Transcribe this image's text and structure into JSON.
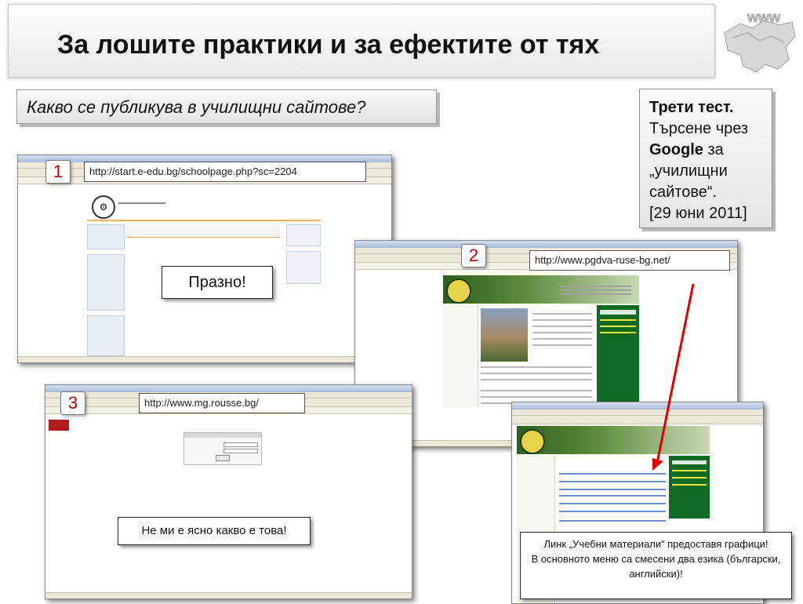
{
  "title": "За лошите практики и за ефектите от тях",
  "subtitle": "Какво се публикува в училищни сайтове?",
  "note": {
    "line1": "Трети тест.",
    "line2": "Търсене чрез",
    "google": "Google",
    "line3_rest": " за",
    "line4": "„училищни сайтове“.",
    "line5": "[29 юни 2011]"
  },
  "logo": {
    "text": "www",
    "icon": "globe-map-icon"
  },
  "screens": [
    {
      "number": "1",
      "url": "http://start.e-edu.bg/schoolpage.php?sc=2204",
      "comment": "Празно!"
    },
    {
      "number": "2",
      "url": "http://www.pgdva-ruse-bg.net/"
    },
    {
      "number": "3",
      "url": "http://www.mg.rousse.bg/",
      "comment": "Не ми е ясно какво е това!"
    }
  ],
  "screen2_comment": {
    "line1": "Линк „Учебни материали“ предоставя графици!",
    "line2": "В основното меню са смесени два езика (български, английски)!"
  },
  "colors": {
    "number_red": "#c00000",
    "arrow_red": "#e00000",
    "site_green": "#0f6a24"
  }
}
